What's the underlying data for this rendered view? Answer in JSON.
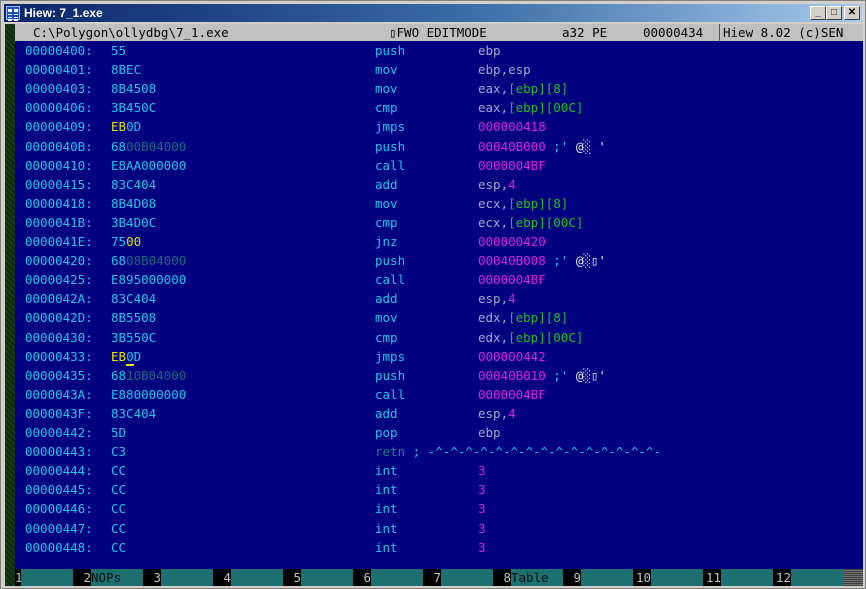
{
  "window": {
    "title": "Hiew: 7_1.exe",
    "controls": {
      "minimize": "_",
      "maximize": "□",
      "close": "✕"
    }
  },
  "status": {
    "path": "C:\\Polygon\\ollydbg\\7_1.exe",
    "mode": "▯FWO EDITMODE",
    "arch": "a32 PE",
    "offset": "00000434",
    "version": "Hiew 8.02 (c)SEN"
  },
  "colors": {
    "background": "#000080",
    "address": "#1ec8e6",
    "immediate": "#e020e0",
    "memory_operand": "#20c020",
    "edited_bytes": "#e6e600",
    "status_bar": "#c0c0c0",
    "fkey_label_bg": "#1c7070"
  },
  "listing": [
    {
      "addr": "00000400:",
      "bytes": [
        {
          "t": "55",
          "c": ""
        }
      ],
      "mnemonic": "push",
      "operand": [
        {
          "t": "ebp",
          "c": ""
        }
      ]
    },
    {
      "addr": "00000401:",
      "bytes": [
        {
          "t": "8BEC",
          "c": ""
        }
      ],
      "mnemonic": "mov",
      "operand": [
        {
          "t": "ebp,esp",
          "c": ""
        }
      ]
    },
    {
      "addr": "00000403:",
      "bytes": [
        {
          "t": "8B4508",
          "c": ""
        }
      ],
      "mnemonic": "mov",
      "operand": [
        {
          "t": "eax,",
          "c": ""
        },
        {
          "t": "[ebp][8]",
          "c": "grn"
        }
      ]
    },
    {
      "addr": "00000406:",
      "bytes": [
        {
          "t": "3B450C",
          "c": ""
        }
      ],
      "mnemonic": "cmp",
      "operand": [
        {
          "t": "eax,",
          "c": ""
        },
        {
          "t": "[ebp][00C]",
          "c": "grn"
        }
      ]
    },
    {
      "addr": "00000409:",
      "bytes": [
        {
          "t": "EB",
          "c": "yel"
        },
        {
          "t": "0D",
          "c": ""
        }
      ],
      "mnemonic": "jmps",
      "operand": [
        {
          "t": "000000418",
          "c": "mag"
        }
      ]
    },
    {
      "addr": "0000040B:",
      "bytes": [
        {
          "t": "68",
          "c": ""
        },
        {
          "t": "00B04000",
          "c": "teal-dim"
        }
      ],
      "mnemonic": "push",
      "operand": [
        {
          "t": "00040B000",
          "c": "mag"
        },
        {
          "t": " ;'",
          "c": "cya"
        },
        {
          "t": " @░ '",
          "c": "wht"
        }
      ]
    },
    {
      "addr": "00000410:",
      "bytes": [
        {
          "t": "E8AA000000",
          "c": ""
        }
      ],
      "mnemonic": "call",
      "operand": [
        {
          "t": "0000004BF",
          "c": "mag"
        }
      ]
    },
    {
      "addr": "00000415:",
      "bytes": [
        {
          "t": "83C404",
          "c": ""
        }
      ],
      "mnemonic": "add",
      "operand": [
        {
          "t": "esp,",
          "c": ""
        },
        {
          "t": "4",
          "c": "mag"
        }
      ]
    },
    {
      "addr": "00000418:",
      "bytes": [
        {
          "t": "8B4D08",
          "c": ""
        }
      ],
      "mnemonic": "mov",
      "operand": [
        {
          "t": "ecx,",
          "c": ""
        },
        {
          "t": "[ebp][8]",
          "c": "grn"
        }
      ]
    },
    {
      "addr": "0000041B:",
      "bytes": [
        {
          "t": "3B4D0C",
          "c": ""
        }
      ],
      "mnemonic": "cmp",
      "operand": [
        {
          "t": "ecx,",
          "c": ""
        },
        {
          "t": "[ebp][00C]",
          "c": "grn"
        }
      ]
    },
    {
      "addr": "0000041E:",
      "bytes": [
        {
          "t": "75",
          "c": ""
        },
        {
          "t": "00",
          "c": "yel"
        }
      ],
      "mnemonic": "jnz",
      "operand": [
        {
          "t": "000000420",
          "c": "mag"
        }
      ]
    },
    {
      "addr": "00000420:",
      "bytes": [
        {
          "t": "68",
          "c": ""
        },
        {
          "t": "08B04000",
          "c": "teal-dim"
        }
      ],
      "mnemonic": "push",
      "operand": [
        {
          "t": "00040B008",
          "c": "mag"
        },
        {
          "t": " ;'",
          "c": "cya"
        },
        {
          "t": " @░▯'",
          "c": "wht"
        }
      ]
    },
    {
      "addr": "00000425:",
      "bytes": [
        {
          "t": "E895000000",
          "c": ""
        }
      ],
      "mnemonic": "call",
      "operand": [
        {
          "t": "0000004BF",
          "c": "mag"
        }
      ]
    },
    {
      "addr": "0000042A:",
      "bytes": [
        {
          "t": "83C404",
          "c": ""
        }
      ],
      "mnemonic": "add",
      "operand": [
        {
          "t": "esp,",
          "c": ""
        },
        {
          "t": "4",
          "c": "mag"
        }
      ]
    },
    {
      "addr": "0000042D:",
      "bytes": [
        {
          "t": "8B5508",
          "c": ""
        }
      ],
      "mnemonic": "mov",
      "operand": [
        {
          "t": "edx,",
          "c": ""
        },
        {
          "t": "[ebp][8]",
          "c": "grn"
        }
      ]
    },
    {
      "addr": "00000430:",
      "bytes": [
        {
          "t": "3B550C",
          "c": ""
        }
      ],
      "mnemonic": "cmp",
      "operand": [
        {
          "t": "edx,",
          "c": ""
        },
        {
          "t": "[ebp][00C]",
          "c": "grn"
        }
      ]
    },
    {
      "addr": "00000433:",
      "bytes": [
        {
          "t": "EB",
          "c": "yel"
        },
        {
          "t": "0",
          "c": "cursor"
        },
        {
          "t": "D",
          "c": ""
        }
      ],
      "mnemonic": "jmps",
      "operand": [
        {
          "t": "000000442",
          "c": "mag"
        }
      ]
    },
    {
      "addr": "00000435:",
      "bytes": [
        {
          "t": "68",
          "c": ""
        },
        {
          "t": "10B04000",
          "c": "teal-dim"
        }
      ],
      "mnemonic": "push",
      "operand": [
        {
          "t": "00040B010",
          "c": "mag"
        },
        {
          "t": " ;'",
          "c": "cya"
        },
        {
          "t": " @░▯'",
          "c": "wht"
        }
      ]
    },
    {
      "addr": "0000043A:",
      "bytes": [
        {
          "t": "E880000000",
          "c": ""
        }
      ],
      "mnemonic": "call",
      "operand": [
        {
          "t": "0000004BF",
          "c": "mag"
        }
      ]
    },
    {
      "addr": "0000043F:",
      "bytes": [
        {
          "t": "83C404",
          "c": ""
        }
      ],
      "mnemonic": "add",
      "operand": [
        {
          "t": "esp,",
          "c": ""
        },
        {
          "t": "4",
          "c": "mag"
        }
      ]
    },
    {
      "addr": "00000442:",
      "bytes": [
        {
          "t": "5D",
          "c": ""
        }
      ],
      "mnemonic": "pop",
      "operand": [
        {
          "t": "ebp",
          "c": ""
        }
      ]
    },
    {
      "addr": "00000443:",
      "bytes": [
        {
          "t": "C3",
          "c": ""
        }
      ],
      "mnemonic": "retn ; -^-^-^-^-^-^-^-^-^-^-^-^-^-^-^-",
      "mnemonic_style": "retn",
      "operand": []
    },
    {
      "addr": "00000444:",
      "bytes": [
        {
          "t": "CC",
          "c": ""
        }
      ],
      "mnemonic": "int",
      "operand": [
        {
          "t": "3",
          "c": "mag"
        }
      ]
    },
    {
      "addr": "00000445:",
      "bytes": [
        {
          "t": "CC",
          "c": ""
        }
      ],
      "mnemonic": "int",
      "operand": [
        {
          "t": "3",
          "c": "mag"
        }
      ]
    },
    {
      "addr": "00000446:",
      "bytes": [
        {
          "t": "CC",
          "c": ""
        }
      ],
      "mnemonic": "int",
      "operand": [
        {
          "t": "3",
          "c": "mag"
        }
      ]
    },
    {
      "addr": "00000447:",
      "bytes": [
        {
          "t": "CC",
          "c": ""
        }
      ],
      "mnemonic": "int",
      "operand": [
        {
          "t": "3",
          "c": "mag"
        }
      ]
    },
    {
      "addr": "00000448:",
      "bytes": [
        {
          "t": "CC",
          "c": ""
        }
      ],
      "mnemonic": "int",
      "operand": [
        {
          "t": "3",
          "c": "mag"
        }
      ]
    }
  ],
  "fkeys": [
    {
      "num": "1",
      "label": ""
    },
    {
      "num": "2",
      "label": "NOPs"
    },
    {
      "num": "3",
      "label": ""
    },
    {
      "num": "4",
      "label": ""
    },
    {
      "num": "5",
      "label": ""
    },
    {
      "num": "6",
      "label": ""
    },
    {
      "num": "7",
      "label": ""
    },
    {
      "num": "8",
      "label": "Table"
    },
    {
      "num": "9",
      "label": ""
    },
    {
      "num": "10",
      "label": ""
    },
    {
      "num": "11",
      "label": ""
    },
    {
      "num": "12",
      "label": ""
    }
  ]
}
